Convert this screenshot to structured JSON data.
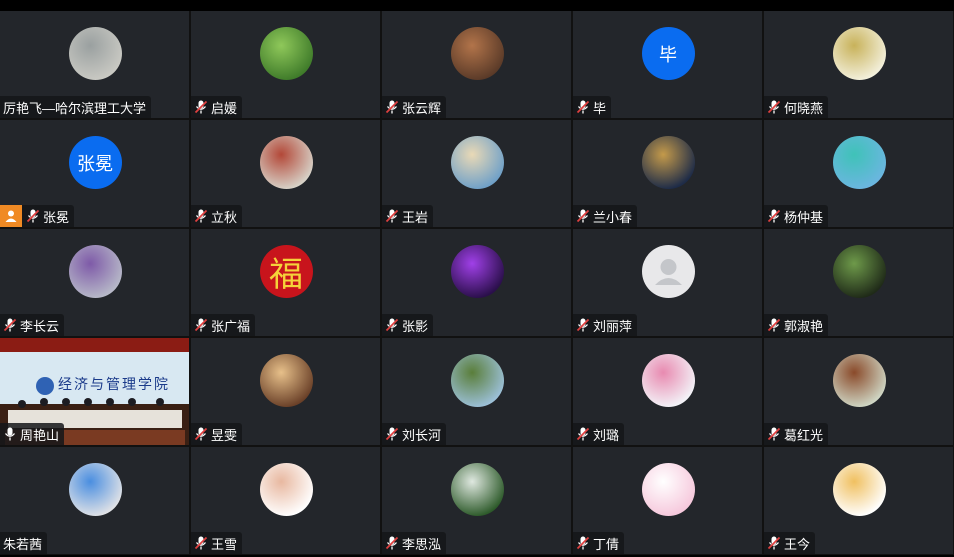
{
  "participants": [
    {
      "name": "厉艳飞—哈尔滨理工大学",
      "avatar": "photo",
      "colors": [
        "#c9c9c3",
        "#9aa0a0"
      ],
      "mic": "none"
    },
    {
      "name": "启媛",
      "avatar": "photo",
      "colors": [
        "#3f7b2a",
        "#8fc85a"
      ],
      "mic": "muted"
    },
    {
      "name": "张云辉",
      "avatar": "photo",
      "colors": [
        "#5a3a28",
        "#b2744a"
      ],
      "mic": "muted"
    },
    {
      "name": "毕",
      "avatar": "text",
      "text": "毕",
      "mic": "muted"
    },
    {
      "name": "何晓燕",
      "avatar": "photo",
      "colors": [
        "#f3f0dc",
        "#c8b25a"
      ],
      "mic": "muted"
    },
    {
      "name": "张冕",
      "avatar": "text",
      "text": "张冕",
      "mic": "muted",
      "host": true
    },
    {
      "name": "立秋",
      "avatar": "photo",
      "colors": [
        "#d7d2c8",
        "#b34838"
      ],
      "mic": "muted"
    },
    {
      "name": "王岩",
      "avatar": "photo",
      "colors": [
        "#6fa0c8",
        "#e9d9b6"
      ],
      "mic": "muted"
    },
    {
      "name": "兰小春",
      "avatar": "photo",
      "colors": [
        "#1d2b48",
        "#c49a4a"
      ],
      "mic": "muted"
    },
    {
      "name": "杨仲基",
      "avatar": "photo",
      "colors": [
        "#6bb6e0",
        "#3fc2b8"
      ],
      "mic": "muted"
    },
    {
      "name": "李长云",
      "avatar": "photo",
      "colors": [
        "#b7b9c8",
        "#7e5aa8"
      ],
      "mic": "muted"
    },
    {
      "name": "张广福",
      "avatar": "fu",
      "text": "福",
      "mic": "muted"
    },
    {
      "name": "张影",
      "avatar": "photo",
      "colors": [
        "#2a0f4a",
        "#a040e8"
      ],
      "mic": "muted"
    },
    {
      "name": "刘丽萍",
      "avatar": "default",
      "mic": "muted"
    },
    {
      "name": "郭淑艳",
      "avatar": "photo",
      "colors": [
        "#1f2a18",
        "#6e9a4a"
      ],
      "mic": "muted"
    },
    {
      "name": "周艳山",
      "avatar": "video",
      "mic": "on",
      "active": true
    },
    {
      "name": "昱雯",
      "avatar": "photo",
      "colors": [
        "#6a4028",
        "#e7c08a"
      ],
      "mic": "muted"
    },
    {
      "name": "刘长河",
      "avatar": "photo",
      "colors": [
        "#9cc0d8",
        "#5a7e3a"
      ],
      "mic": "muted"
    },
    {
      "name": "刘璐",
      "avatar": "photo",
      "colors": [
        "#f3f3f8",
        "#e88ab0"
      ],
      "mic": "muted"
    },
    {
      "name": "葛红光",
      "avatar": "photo",
      "colors": [
        "#cfd6c4",
        "#8a4a2a"
      ],
      "mic": "muted"
    },
    {
      "name": "朱若茜",
      "avatar": "photo",
      "colors": [
        "#e0e2e6",
        "#4a8ee0"
      ],
      "mic": "none"
    },
    {
      "name": "王雪",
      "avatar": "photo",
      "colors": [
        "#ffffff",
        "#e8b8a0"
      ],
      "mic": "muted"
    },
    {
      "name": "李思泓",
      "avatar": "photo",
      "colors": [
        "#2d5a2a",
        "#dfe8e0"
      ],
      "mic": "muted"
    },
    {
      "name": "丁倩",
      "avatar": "photo",
      "colors": [
        "#f6c8dc",
        "#ffffff"
      ],
      "mic": "muted"
    },
    {
      "name": "王今",
      "avatar": "photo",
      "colors": [
        "#ffffff",
        "#f0c060"
      ],
      "mic": "muted"
    }
  ],
  "video_banner": "经济与管理学院",
  "colors": {
    "tile_bg": "#23262b",
    "mic_muted": "#e04040",
    "mic_on": "#ffffff",
    "host_badge": "#f08a24",
    "text_avatar": "#0a6cf0",
    "active_border": "#3bbf4f"
  }
}
